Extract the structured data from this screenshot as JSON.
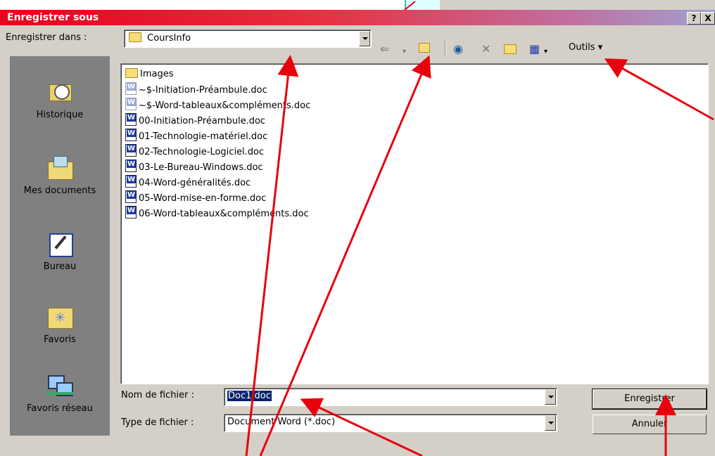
{
  "dialog": {
    "title": "Enregistrer sous",
    "help_btn": "?",
    "close_btn": "X"
  },
  "save_in": {
    "label": "Enregistrer dans :",
    "value": "CoursInfo"
  },
  "toolbar": {
    "tools_label": "Outils",
    "icons": [
      "back-arrow-icon",
      "up-folder-icon",
      "web-search-icon",
      "delete-icon",
      "new-folder-icon",
      "views-icon"
    ]
  },
  "places": [
    {
      "label": "Historique",
      "icon": "history-icon"
    },
    {
      "label": "Mes documents",
      "icon": "my-documents-icon"
    },
    {
      "label": "Bureau",
      "icon": "desktop-icon"
    },
    {
      "label": "Favoris",
      "icon": "favorites-icon"
    },
    {
      "label": "Favoris réseau",
      "icon": "network-icon"
    }
  ],
  "files": [
    {
      "name": "Images",
      "type": "folder"
    },
    {
      "name": "~$-Initiation-Préambule.doc",
      "type": "temp"
    },
    {
      "name": "~$-Word-tableaux&compléments.doc",
      "type": "temp"
    },
    {
      "name": "00-Initiation-Préambule.doc",
      "type": "doc"
    },
    {
      "name": "01-Technologie-matériel.doc",
      "type": "doc"
    },
    {
      "name": "02-Technologie-Logiciel.doc",
      "type": "doc"
    },
    {
      "name": "03-Le-Bureau-Windows.doc",
      "type": "doc"
    },
    {
      "name": "04-Word-généralités.doc",
      "type": "doc"
    },
    {
      "name": "05-Word-mise-en-forme.doc",
      "type": "doc"
    },
    {
      "name": "06-Word-tableaux&compléments.doc",
      "type": "doc"
    }
  ],
  "filename": {
    "label": "Nom de fichier :",
    "value": "Doc1.doc"
  },
  "filetype": {
    "label": "Type de fichier :",
    "value": "Document Word (*.doc)"
  },
  "buttons": {
    "save": "Enregistrer",
    "cancel": "Annuler"
  },
  "colors": {
    "accent": "#e8001c",
    "face": "#d4d0c8",
    "annotation_arrow": "#e8000c"
  }
}
